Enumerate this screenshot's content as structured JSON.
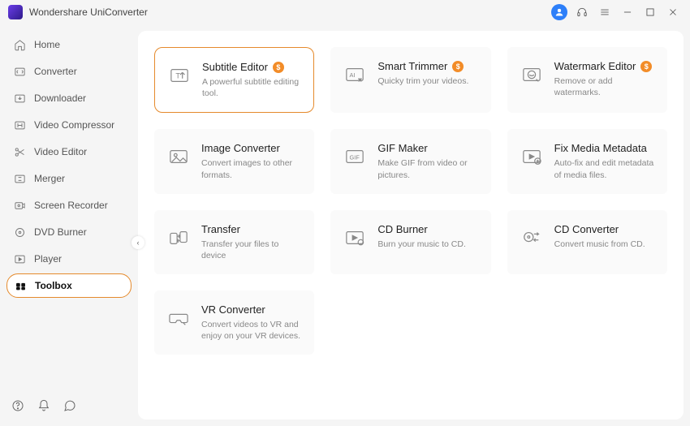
{
  "app_title": "Wondershare UniConverter",
  "sidebar": {
    "items": [
      {
        "label": "Home",
        "icon": "home-icon"
      },
      {
        "label": "Converter",
        "icon": "converter-icon"
      },
      {
        "label": "Downloader",
        "icon": "download-icon"
      },
      {
        "label": "Video Compressor",
        "icon": "compress-icon"
      },
      {
        "label": "Video Editor",
        "icon": "scissors-icon"
      },
      {
        "label": "Merger",
        "icon": "merge-icon"
      },
      {
        "label": "Screen Recorder",
        "icon": "record-icon"
      },
      {
        "label": "DVD Burner",
        "icon": "disc-icon"
      },
      {
        "label": "Player",
        "icon": "play-icon"
      },
      {
        "label": "Toolbox",
        "icon": "toolbox-icon",
        "active": true
      }
    ]
  },
  "toolbox": {
    "badge_symbol": "$",
    "cards": [
      {
        "title": "Subtitle Editor",
        "desc": "A powerful subtitle editing tool.",
        "icon": "subtitle-icon",
        "badge": true,
        "selected": true
      },
      {
        "title": "Smart Trimmer",
        "desc": "Quicky trim your videos.",
        "icon": "ai-trim-icon",
        "badge": true
      },
      {
        "title": "Watermark Editor",
        "desc": "Remove or add watermarks.",
        "icon": "watermark-icon",
        "badge": true
      },
      {
        "title": "Image Converter",
        "desc": "Convert images to other formats.",
        "icon": "image-icon"
      },
      {
        "title": "GIF Maker",
        "desc": "Make GIF from video or pictures.",
        "icon": "gif-icon"
      },
      {
        "title": "Fix Media Metadata",
        "desc": "Auto-fix and edit metadata of media files.",
        "icon": "metadata-icon"
      },
      {
        "title": "Transfer",
        "desc": "Transfer your files to device",
        "icon": "transfer-icon"
      },
      {
        "title": "CD Burner",
        "desc": "Burn your music to CD.",
        "icon": "cd-burn-icon"
      },
      {
        "title": "CD Converter",
        "desc": "Convert music from CD.",
        "icon": "cd-convert-icon"
      },
      {
        "title": "VR Converter",
        "desc": "Convert videos to VR and enjoy on your VR devices.",
        "icon": "vr-icon"
      }
    ]
  }
}
